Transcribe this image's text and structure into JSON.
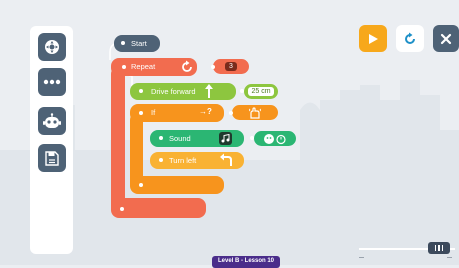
{
  "sidebar": {
    "items": [
      {
        "name": "controls",
        "icon": "dpad-icon"
      },
      {
        "name": "more",
        "icon": "more-icon"
      },
      {
        "name": "robot",
        "icon": "robot-icon"
      },
      {
        "name": "save",
        "icon": "save-icon"
      }
    ]
  },
  "controls": {
    "play": {
      "icon": "play-icon",
      "color": "#f7a81b"
    },
    "reset": {
      "icon": "reset-icon",
      "color": "#ffffff"
    },
    "close": {
      "icon": "close-icon",
      "color": "#4e6276"
    }
  },
  "program": {
    "start": {
      "label": "Start",
      "color": "#4e6276"
    },
    "repeat": {
      "label": "Repeat",
      "count": "3",
      "color": "#f26c4f",
      "icon": "repeat-icon"
    },
    "drive": {
      "label": "Drive forward",
      "distance": "25 cm",
      "color": "#8dc63f",
      "icon": "up-arrow-icon"
    },
    "if": {
      "label": "If",
      "condition": "→?",
      "color": "#f7941d",
      "icon": "sensor-hand-icon"
    },
    "sound": {
      "label": "Sound",
      "color": "#2bb673",
      "icon": "music-note-icon",
      "param_icon": "sound-face-icon"
    },
    "turn": {
      "label": "Turn left",
      "color": "#f9b233",
      "icon": "turn-left-icon"
    }
  },
  "footer": {
    "level_label": "Level B - Lesson 10"
  },
  "colors": {
    "background": "#ebeef2",
    "skyline": "#dfe5ea",
    "toolbar_button": "#4e6276"
  }
}
